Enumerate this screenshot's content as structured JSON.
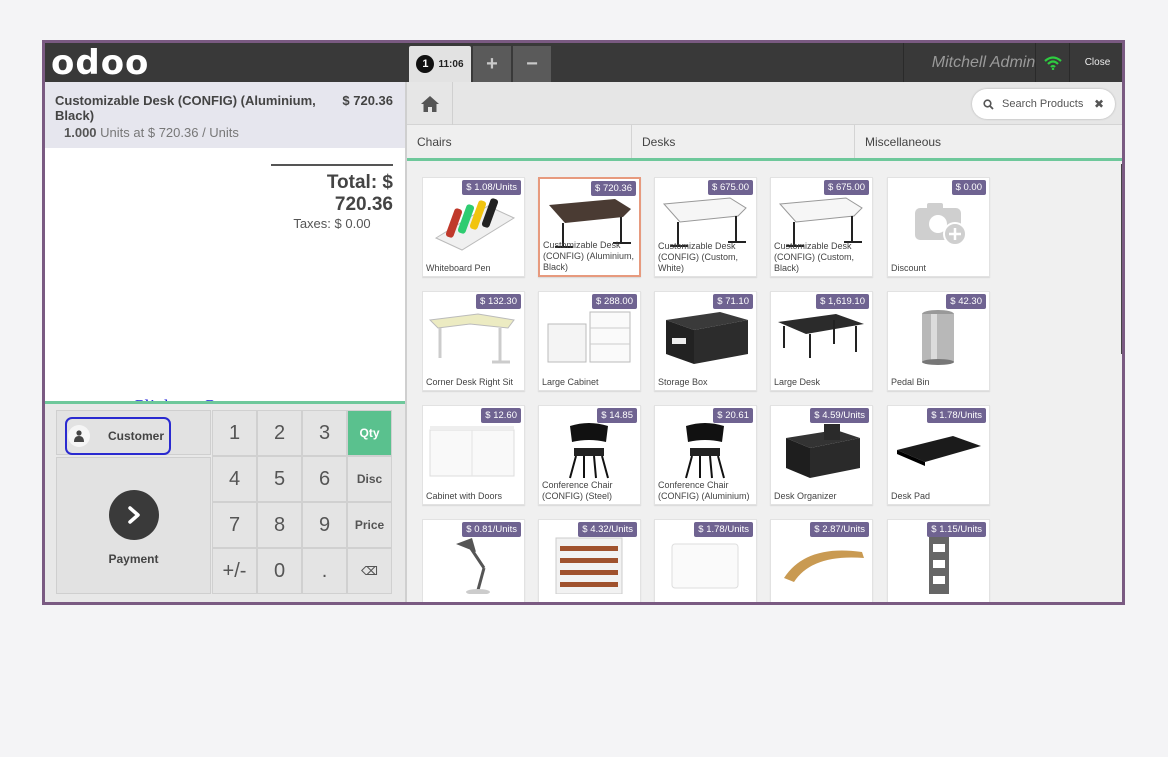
{
  "topbar": {
    "logo": "odoo",
    "order_number": "1",
    "order_time": "11:06",
    "add_label": "+",
    "remove_label": "−",
    "username": "Mitchell Admin",
    "close_label": "Close"
  },
  "order": {
    "line_name": "Customizable Desk (CONFIG) (Aluminium, Black)",
    "line_price": "$ 720.36",
    "line_qty": "1.000",
    "line_unit": "Units at $ 720.36 / Units",
    "total": "Total: $ 720.36",
    "taxes": "Taxes: $ 0.00"
  },
  "annotation": "Click on Customer",
  "control": {
    "customer_label": "Customer",
    "payment_label": "Payment",
    "keys": [
      "1",
      "2",
      "3",
      "Qty",
      "4",
      "5",
      "6",
      "Disc",
      "7",
      "8",
      "9",
      "Price",
      "+/-",
      "0",
      ".",
      "⌫"
    ]
  },
  "search": {
    "placeholder": "Search Products"
  },
  "categories": [
    "Chairs",
    "Desks",
    "Miscellaneous"
  ],
  "products": [
    {
      "name": "Whiteboard Pen",
      "price": "$ 1.08/Units",
      "icon": "whiteboard-pen"
    },
    {
      "name": "Customizable Desk (CONFIG) (Aluminium, Black)",
      "price": "$ 720.36",
      "icon": "desk-dark",
      "selected": true
    },
    {
      "name": "Customizable Desk (CONFIG) (Custom, White)",
      "price": "$ 675.00",
      "icon": "desk-white"
    },
    {
      "name": "Customizable Desk (CONFIG) (Custom, Black)",
      "price": "$ 675.00",
      "icon": "desk-white"
    },
    {
      "name": "Discount",
      "price": "$ 0.00",
      "icon": "camera-plus"
    },
    {
      "name": "Corner Desk Right Sit",
      "price": "$ 132.30",
      "icon": "corner-desk"
    },
    {
      "name": "Large Cabinet",
      "price": "$ 288.00",
      "icon": "cabinet"
    },
    {
      "name": "Storage Box",
      "price": "$ 71.10",
      "icon": "storage-box"
    },
    {
      "name": "Large Desk",
      "price": "$ 1,619.10",
      "icon": "large-desk"
    },
    {
      "name": "Pedal Bin",
      "price": "$ 42.30",
      "icon": "pedal-bin"
    },
    {
      "name": "Cabinet with Doors",
      "price": "$ 12.60",
      "icon": "cabinet-doors"
    },
    {
      "name": "Conference Chair (CONFIG) (Steel)",
      "price": "$ 14.85",
      "icon": "chair"
    },
    {
      "name": "Conference Chair (CONFIG) (Aluminium)",
      "price": "$ 20.61",
      "icon": "chair"
    },
    {
      "name": "Desk Organizer",
      "price": "$ 4.59/Units",
      "icon": "desk-organizer"
    },
    {
      "name": "Desk Pad",
      "price": "$ 1.78/Units",
      "icon": "desk-pad"
    },
    {
      "name": "",
      "price": "$ 0.81/Units",
      "icon": "lamp"
    },
    {
      "name": "",
      "price": "$ 4.32/Units",
      "icon": "shelf"
    },
    {
      "name": "",
      "price": "$ 1.78/Units",
      "icon": "pad-white"
    },
    {
      "name": "",
      "price": "$ 2.87/Units",
      "icon": "monitor-stand"
    },
    {
      "name": "",
      "price": "$ 1.15/Units",
      "icon": "wall-rack"
    }
  ],
  "colors": {
    "topbar": "#393939",
    "accent_green": "#5ac18e",
    "price_tag": "#6f6391",
    "annotation_blue": "#1a1ad8",
    "frame": "#7a5a82"
  }
}
